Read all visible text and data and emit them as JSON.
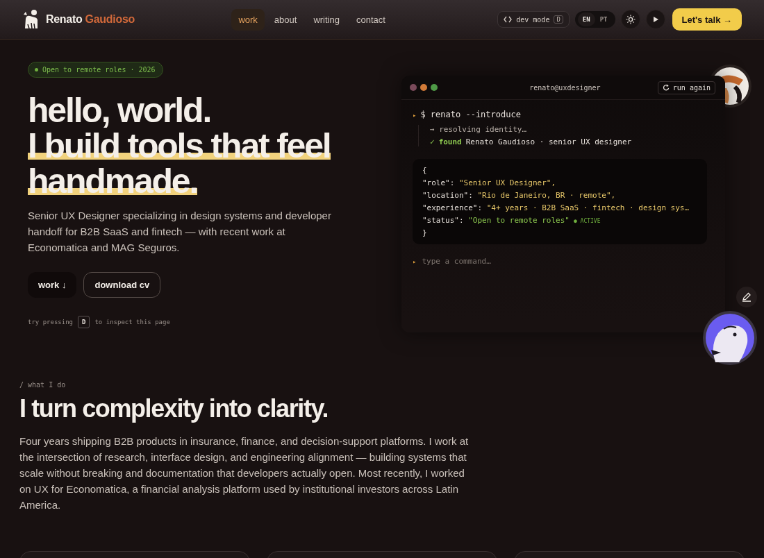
{
  "nav": {
    "brand_first": "Renato",
    "brand_last": "Gaudioso",
    "links": [
      {
        "label": "work",
        "selected": true
      },
      {
        "label": "about",
        "selected": false
      },
      {
        "label": "writing",
        "selected": false
      },
      {
        "label": "contact",
        "selected": false
      }
    ],
    "dev_mode": {
      "label": "dev mode",
      "key": "D"
    },
    "languages": [
      {
        "label": "EN",
        "selected": true
      },
      {
        "label": "PT",
        "selected": false
      }
    ],
    "cta": "Let's talk →"
  },
  "hero": {
    "badge": "Open to remote roles · 2026",
    "heading": "hello, world.",
    "heading_highlight": "I build tools that feel handmade.",
    "intro": "Senior UX Designer specializing in design systems and developer handoff for B2B SaaS and fintech — with recent work at Economatica and MAG Seguros.",
    "buttons": [
      {
        "label": "work ↓",
        "kind": "primary"
      },
      {
        "label": "download cv",
        "kind": "outline"
      }
    ],
    "hint_before": "try pressing",
    "hint_key": "D",
    "hint_after": "to inspect this page"
  },
  "terminal": {
    "title": "renato@uxdesigner",
    "run_again": "run again",
    "prompt_mark": "▸",
    "command": "$ renato --introduce",
    "resolving": "→ resolving identity…",
    "check": "✓",
    "found_label": "found",
    "found_text": "Renato Gaudioso · senior UX designer",
    "open_brace": "{",
    "close_brace": "}",
    "fields": [
      {
        "key": "\"role\":",
        "value": "\"Senior UX Designer\",",
        "kind": "text"
      },
      {
        "key": "\"location\":",
        "value": "\"Rio de Janeiro, BR · remote\",",
        "kind": "text"
      },
      {
        "key": "\"experience\":",
        "value": "\"4+ years · B2B SaaS · fintech · design sys…",
        "kind": "text"
      },
      {
        "key": "\"status\":",
        "value": "\"Open to remote roles\"",
        "kind": "status",
        "badge": "● ACTIVE"
      }
    ],
    "input_mark": "▸",
    "input_placeholder": "type a command…"
  },
  "about": {
    "eyebrow": "/ what I do",
    "heading": "I turn complexity into clarity.",
    "body": "Four years shipping B2B products in insurance, finance, and decision-support platforms. I work at the intersection of research, interface design, and engineering alignment — building systems that scale without breaking and documentation that developers actually open. Most recently, I worked on UX for Economatica, a financial analysis platform used by institutional investors across Latin America."
  },
  "cards": [
    {
      "kind": "card"
    },
    {
      "kind": "card"
    },
    {
      "kind": "card"
    }
  ]
}
